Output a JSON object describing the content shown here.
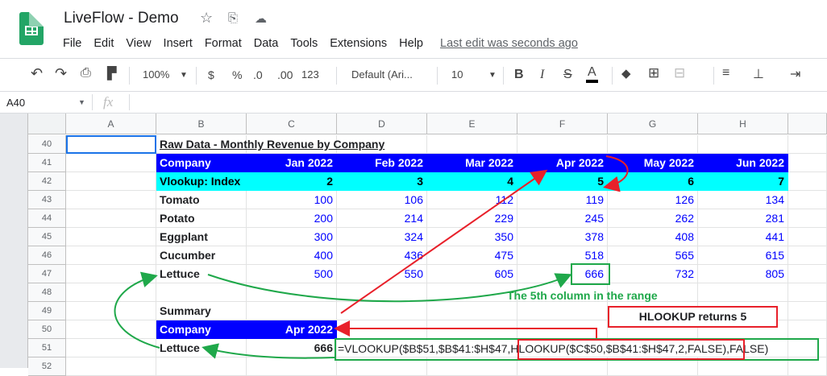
{
  "app": {
    "title": "LiveFlow - Demo",
    "menu": [
      "File",
      "Edit",
      "View",
      "Insert",
      "Format",
      "Data",
      "Tools",
      "Extensions",
      "Help"
    ],
    "last_edit": "Last edit was seconds ago"
  },
  "toolbar": {
    "zoom": "100%",
    "currency": "$",
    "percent": "%",
    "dec_less": ".0",
    "dec_more": ".00",
    "format": "123",
    "font": "Default (Ari...",
    "font_size": "10",
    "bold": "B",
    "italic": "I",
    "strike": "S",
    "text_color": "A"
  },
  "formula_bar": {
    "cell_ref": "A40",
    "fx": "fx",
    "value": ""
  },
  "columns": [
    "A",
    "B",
    "C",
    "D",
    "E",
    "F",
    "G",
    "H"
  ],
  "rows": [
    "40",
    "41",
    "42",
    "43",
    "44",
    "45",
    "46",
    "47",
    "48",
    "49",
    "50",
    "51",
    "52"
  ],
  "sheet": {
    "title": "Raw Data - Monthly Revenue by Company",
    "header": [
      "Company",
      "Jan 2022",
      "Feb 2022",
      "Mar 2022",
      "Apr 2022",
      "May 2022",
      "Jun 2022"
    ],
    "index_row": [
      "Vlookup: Index",
      "2",
      "3",
      "4",
      "5",
      "6",
      "7"
    ],
    "data": [
      [
        "Tomato",
        "100",
        "106",
        "112",
        "119",
        "126",
        "134"
      ],
      [
        "Potato",
        "200",
        "214",
        "229",
        "245",
        "262",
        "281"
      ],
      [
        "Eggplant",
        "300",
        "324",
        "350",
        "378",
        "408",
        "441"
      ],
      [
        "Cucumber",
        "400",
        "436",
        "475",
        "518",
        "565",
        "615"
      ],
      [
        "Lettuce",
        "500",
        "550",
        "605",
        "666",
        "732",
        "805"
      ]
    ],
    "summary_label": "Summary",
    "summary_header": [
      "Company",
      "Apr 2022"
    ],
    "summary_row": [
      "Lettuce",
      "666"
    ],
    "formula_pre": "=VLOOKUP($B$51,$B$41:$H$47,",
    "formula_inner": "HLOOKUP($C$50,$B$41:$H$47,2,FALSE)",
    "formula_post": ",FALSE)"
  },
  "annotations": {
    "fifth_column": "The 5th column in the range",
    "hlookup_returns": "HLOOKUP returns 5"
  },
  "colors": {
    "header_bg": "#0000ff",
    "index_bg": "#00ffff",
    "number": "#0000ff",
    "green": "#1fa84a",
    "red": "#e8202a"
  }
}
